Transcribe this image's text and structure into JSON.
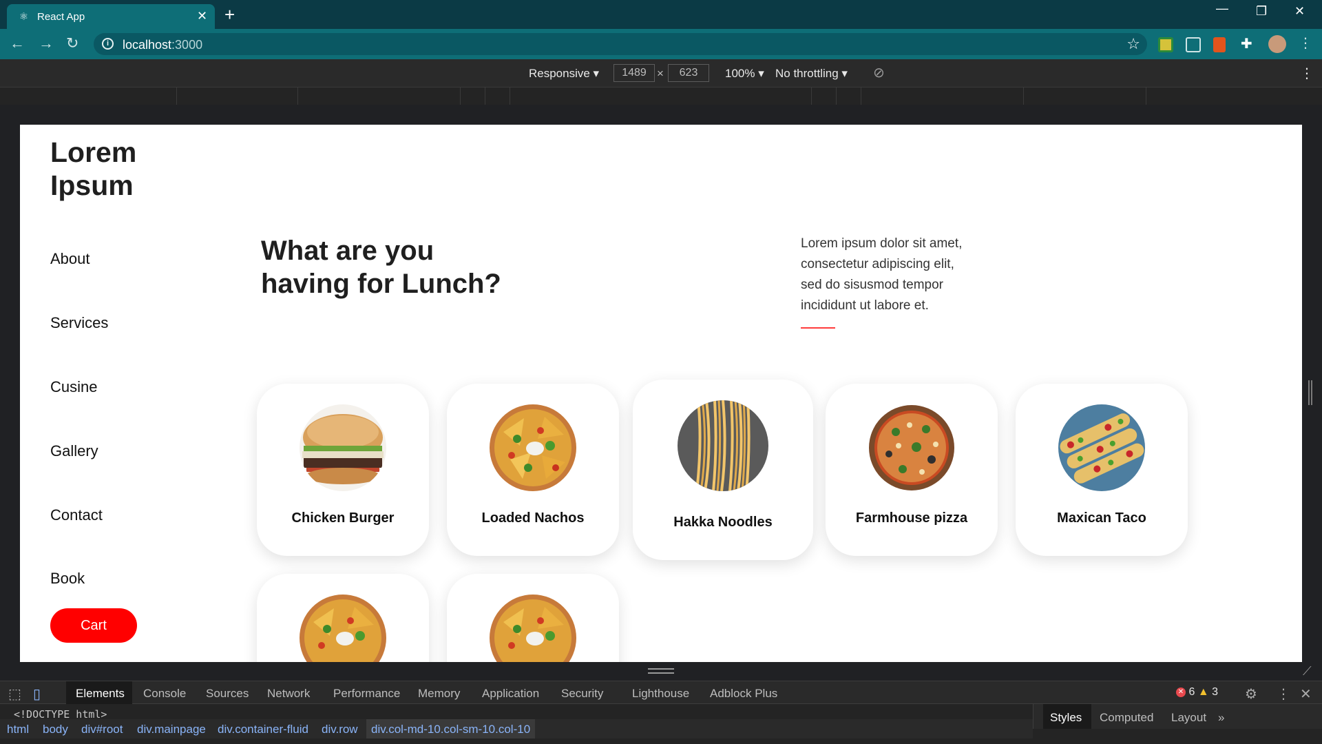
{
  "browser": {
    "tab_title": "React App",
    "url_host": "localhost",
    "url_port": ":3000"
  },
  "device_toolbar": {
    "mode": "Responsive",
    "width": "1489",
    "times": "×",
    "height": "623",
    "zoom": "100%",
    "throttling": "No throttling"
  },
  "page": {
    "logo_line1": "Lorem",
    "logo_line2": "Ipsum",
    "nav": [
      "About",
      "Services",
      "Cusine",
      "Gallery",
      "Contact",
      "Book"
    ],
    "cart_label": "Cart",
    "headline_line1": "What are you",
    "headline_line2": "having for Lunch?",
    "intro_lines": [
      "Lorem ipsum dolor sit amet,",
      "consectetur adipiscing elit,",
      "sed do sisusmod tempor",
      "incididunt ut labore et."
    ],
    "cards": [
      {
        "label": "Chicken Burger",
        "image": "burger-image"
      },
      {
        "label": "Loaded Nachos",
        "image": "nachos-image"
      },
      {
        "label": "Hakka Noodles",
        "image": "noodles-image"
      },
      {
        "label": "Farmhouse pizza",
        "image": "pizza-image"
      },
      {
        "label": "Maxican Taco",
        "image": "taco-image"
      },
      {
        "label": "",
        "image": "nachos-image"
      },
      {
        "label": "",
        "image": "nachos-image"
      }
    ],
    "accent_color": "#ff0000"
  },
  "devtools": {
    "tabs": [
      "Elements",
      "Console",
      "Sources",
      "Network",
      "Performance",
      "Memory",
      "Application",
      "Security",
      "Lighthouse",
      "Adblock Plus"
    ],
    "active_tab": "Elements",
    "errors": "6",
    "warnings": "3",
    "doctype": "<!DOCTYPE html>",
    "breadcrumbs": [
      "html",
      "body",
      "div#root",
      "div.mainpage",
      "div.container-fluid",
      "div.row",
      "div.col-md-10.col-sm-10.col-10"
    ],
    "side_tabs": [
      "Styles",
      "Computed",
      "Layout"
    ],
    "side_more": "»"
  }
}
